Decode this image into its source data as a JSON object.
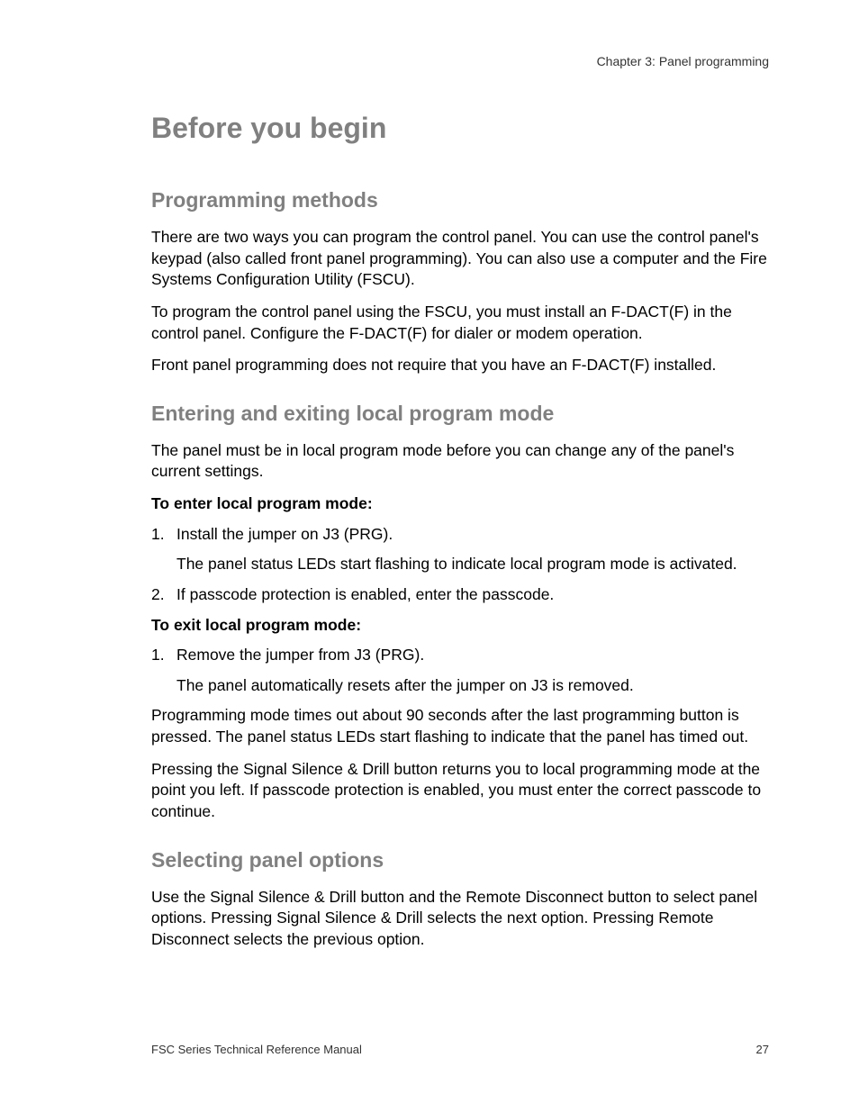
{
  "header": {
    "chapter": "Chapter 3: Panel programming"
  },
  "title": "Before you begin",
  "sections": {
    "s1": {
      "heading": "Programming methods",
      "p1": "There are two ways you can program the control panel. You can use the control panel's keypad (also called front panel programming). You can also use a computer and the Fire Systems Configuration Utility (FSCU).",
      "p2": "To program the control panel using the FSCU, you must install an F-DACT(F) in the control panel. Configure the F-DACT(F) for dialer or modem operation.",
      "p3": "Front panel programming does not require that you have an F-DACT(F) installed."
    },
    "s2": {
      "heading": "Entering and exiting local program mode",
      "p1": "The panel must be in local program mode before you can change any of the panel's current settings.",
      "lead1": "To enter local program mode:",
      "li1_num": "1.",
      "li1": "Install the jumper on J3 (PRG).",
      "li1_sub": "The panel status LEDs start flashing to indicate local program mode is activated.",
      "li2_num": "2.",
      "li2": "If passcode protection is enabled, enter the passcode.",
      "lead2": "To exit local program mode:",
      "li3_num": "1.",
      "li3": "Remove the jumper from J3 (PRG).",
      "li3_sub": "The panel automatically resets after the jumper on J3 is removed.",
      "p2": "Programming mode times out about 90 seconds after the last programming button is pressed. The panel status LEDs start flashing to indicate that the panel has timed out.",
      "p3": "Pressing the Signal Silence & Drill button returns you to local programming mode at the point you left. If passcode protection is enabled, you must enter the correct passcode to continue."
    },
    "s3": {
      "heading": "Selecting panel options",
      "p1": "Use the Signal Silence & Drill button and the Remote Disconnect button to select panel options. Pressing Signal Silence & Drill selects the next option. Pressing Remote Disconnect selects the previous option."
    }
  },
  "footer": {
    "left": "FSC Series Technical Reference Manual",
    "right": "27"
  }
}
